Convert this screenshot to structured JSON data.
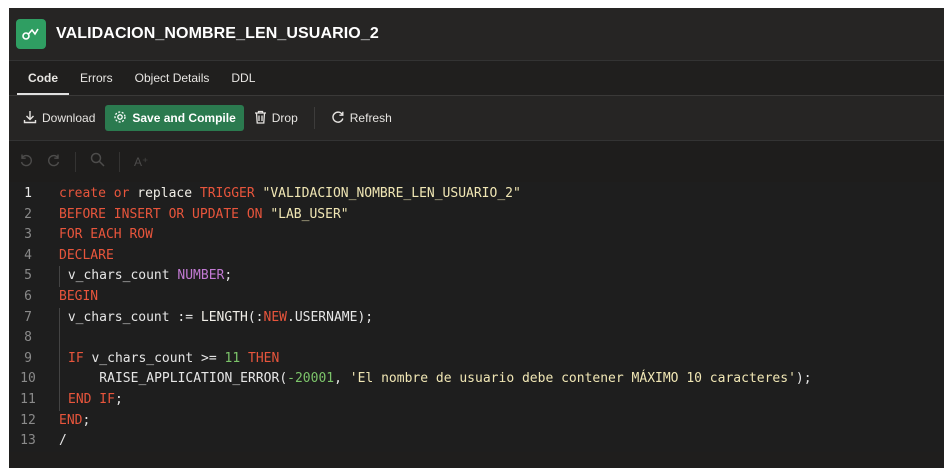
{
  "header": {
    "title": "VALIDACION_NOMBRE_LEN_USUARIO_2",
    "icon": "trigger-icon"
  },
  "tabs": [
    {
      "label": "Code",
      "active": true
    },
    {
      "label": "Errors"
    },
    {
      "label": "Object Details"
    },
    {
      "label": "DDL"
    }
  ],
  "toolbar": {
    "download_label": "Download",
    "save_compile_label": "Save and Compile",
    "drop_label": "Drop",
    "refresh_label": "Refresh"
  },
  "editor_tools": {
    "font_label": "A⁺"
  },
  "code": {
    "line_numbers": [
      "1",
      "2",
      "3",
      "4",
      "5",
      "6",
      "7",
      "8",
      "9",
      "10",
      "11",
      "12",
      "13"
    ],
    "l1": {
      "a": "create",
      "b": " or ",
      "c": "replace",
      "d": " TRIGGER ",
      "e": "\"VALIDACION_NOMBRE_LEN_USUARIO_2\""
    },
    "l2": {
      "a": "BEFORE INSERT OR UPDATE ON ",
      "b": "\"LAB_USER\""
    },
    "l3": {
      "a": "FOR EACH ROW"
    },
    "l4": {
      "a": "DECLARE"
    },
    "l5": {
      "a": " v_chars_count ",
      "b": "NUMBER",
      "c": ";"
    },
    "l6": {
      "a": "BEGIN"
    },
    "l7": {
      "a": " v_chars_count := ",
      "b": "LENGTH",
      "c": "(:",
      "d": "NEW",
      "e": ".USERNAME);"
    },
    "l8": {
      "a": ""
    },
    "l9": {
      "a": "IF",
      "b": " v_chars_count >= ",
      "c": "11",
      "d": " THEN"
    },
    "l10": {
      "a": "    RAISE_APPLICATION_ERROR(",
      "b": "-20001",
      "c": ", ",
      "d": "'El nombre de usuario debe contener MÁXIMO 10 caracteres'",
      "e": ");"
    },
    "l11": {
      "a": "END IF",
      "b": ";"
    },
    "l12": {
      "a": "END",
      "b": ";"
    },
    "l13": {
      "a": "/"
    }
  }
}
